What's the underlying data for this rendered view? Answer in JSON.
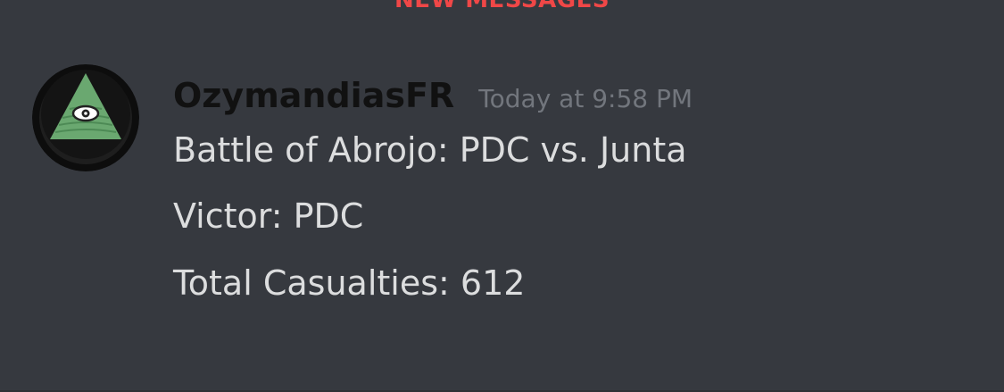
{
  "divider": {
    "label": "NEW MESSAGES"
  },
  "message": {
    "author": "OzymandiasFR",
    "timestamp": "Today at 9:58 PM",
    "avatar_icon": "illuminati-eye-pyramid-icon",
    "lines": [
      "Battle of Abrojo: PDC vs. Junta",
      "Victor: PDC",
      "Total Casualties: 612"
    ]
  },
  "colors": {
    "background": "#36393f",
    "divider": "#f04747",
    "author": "#111111",
    "timestamp": "#72767d",
    "text": "#dcddde",
    "avatar_pyramid": "#6aa870"
  }
}
